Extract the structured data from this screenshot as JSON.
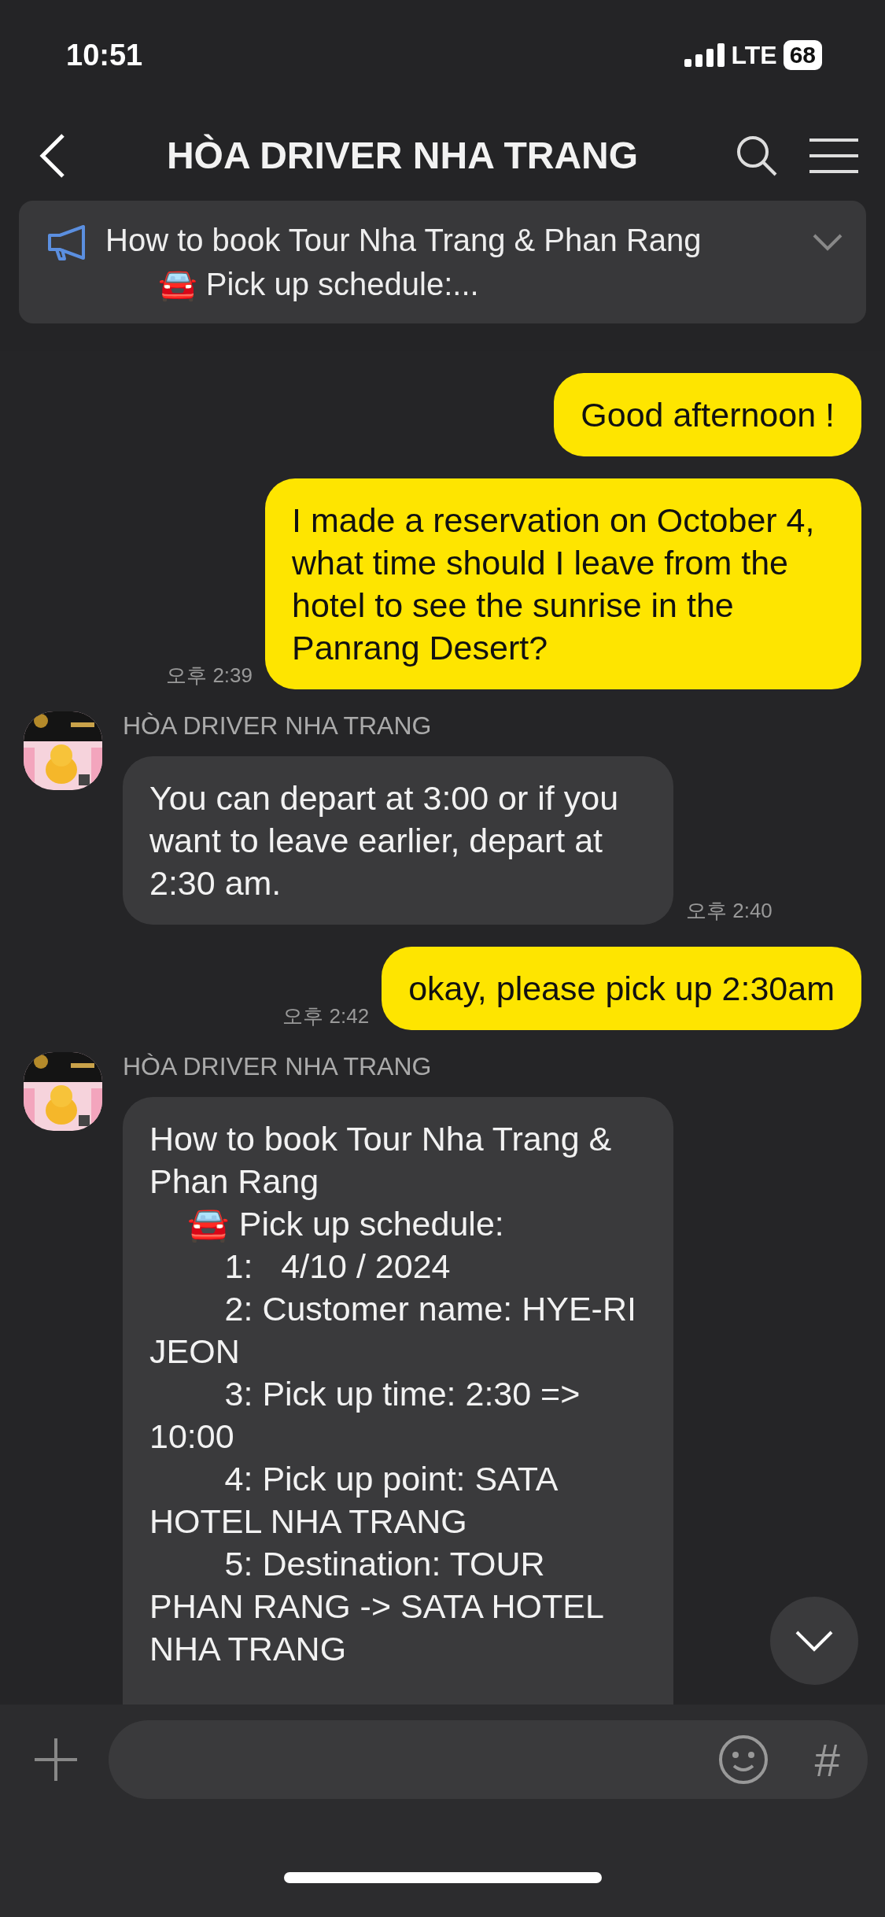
{
  "status_bar": {
    "time": "10:51",
    "network": "LTE",
    "battery": "68"
  },
  "header": {
    "title": "HÒA DRIVER NHA TRANG"
  },
  "notice": {
    "text": "How to book Tour Nha Trang & Phan Rang\n      🚘 Pick up schedule:..."
  },
  "messages": [
    {
      "kind": "sent",
      "text": "Good afternoon !"
    },
    {
      "kind": "sent",
      "text": "I made a reservation on October 4, what time should I leave from the hotel to see the sunrise in the Panrang Desert?",
      "time": "오후 2:39"
    },
    {
      "kind": "received",
      "sender": "HÒA DRIVER NHA TRANG",
      "text": "You can depart at 3:00 or if you want to leave earlier, depart at 2:30 am.",
      "time": "오후 2:40"
    },
    {
      "kind": "sent",
      "text": "okay, please pick up 2:30am",
      "time": "오후 2:42"
    },
    {
      "kind": "received",
      "sender": "HÒA DRIVER NHA TRANG",
      "text": "How to book Tour Nha Trang & Phan Rang\n    🚘 Pick up schedule:\n        1:   4/10 / 2024\n        2: Customer name: HYE-RI JEON\n        3: Pick up time: 2:30 => 10:00\n        4: Pick up point: SATA HOTEL NHA TRANG\n        5: Destination: TOUR PHAN RANG -> SATA HOTEL NHA TRANG"
    }
  ],
  "composer": {
    "hash_label": "#"
  }
}
